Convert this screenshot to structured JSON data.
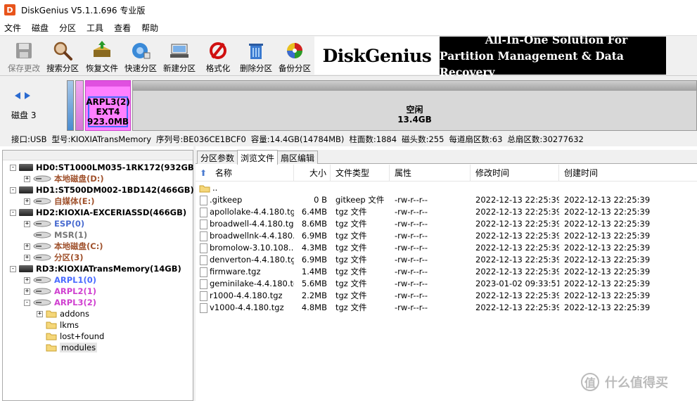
{
  "title": "DiskGenius V5.1.1.696 专业版",
  "menu": [
    "文件",
    "磁盘",
    "分区",
    "工具",
    "查看",
    "帮助"
  ],
  "toolbar": [
    {
      "label": "保存更改",
      "icon": "save-icon"
    },
    {
      "label": "搜索分区",
      "icon": "search-partition-icon"
    },
    {
      "label": "恢复文件",
      "icon": "recover-files-icon"
    },
    {
      "label": "快速分区",
      "icon": "quick-partition-icon"
    },
    {
      "label": "新建分区",
      "icon": "new-partition-icon"
    },
    {
      "label": "格式化",
      "icon": "format-icon"
    },
    {
      "label": "删除分区",
      "icon": "delete-partition-icon"
    },
    {
      "label": "备份分区",
      "icon": "backup-partition-icon"
    }
  ],
  "banner": {
    "logo": "DiskGenius",
    "line1": "All-In-One Solution For",
    "line2": "Partition Management & Data Recovery"
  },
  "diskmap": {
    "disk_label": "磁盘 3",
    "selected": {
      "name": "ARPL3(2)",
      "fs": "EXT4",
      "size": "923.0MB"
    },
    "free": {
      "name": "空闲",
      "size": "13.4GB"
    }
  },
  "infobar": [
    "接口:USB",
    "型号:KIOXIATransMemory",
    "序列号:BE036CE1BCF0",
    "容量:14.4GB(14784MB)",
    "柱面数:1884",
    "磁头数:255",
    "每道扇区数:63",
    "总扇区数:30277632"
  ],
  "tree": [
    {
      "label": "HD0:ST1000LM035-1RK172(932GB)",
      "style": "disk",
      "exp": "-"
    },
    {
      "label": "本地磁盘(D:)",
      "style": "ntfs",
      "exp": "+"
    },
    {
      "label": "HD1:ST500DM002-1BD142(466GB)",
      "style": "disk",
      "exp": "-"
    },
    {
      "label": "自媒体(E:)",
      "style": "ntfs",
      "exp": "+"
    },
    {
      "label": "HD2:KIOXIA-EXCERIASSD(466GB)",
      "style": "disk",
      "exp": "-"
    },
    {
      "label": "ESP(0)",
      "style": "fat",
      "exp": "+"
    },
    {
      "label": "MSR(1)",
      "style": "msr",
      "exp": ""
    },
    {
      "label": "本地磁盘(C:)",
      "style": "ntfs",
      "exp": "+"
    },
    {
      "label": "分区(3)",
      "style": "ntfs",
      "exp": "+"
    },
    {
      "label": "RD3:KIOXIATransMemory(14GB)",
      "style": "disk",
      "exp": "-"
    },
    {
      "label": "ARPL1(0)",
      "style": "arpl1",
      "exp": "+"
    },
    {
      "label": "ARPL2(1)",
      "style": "arpl2",
      "exp": "+"
    },
    {
      "label": "ARPL3(2)",
      "style": "arpl3",
      "exp": "-"
    },
    {
      "label": "addons",
      "style": "dir",
      "exp": "+"
    },
    {
      "label": "lkms",
      "style": "dir",
      "exp": ""
    },
    {
      "label": "lost+found",
      "style": "dir",
      "exp": ""
    },
    {
      "label": "modules",
      "style": "dir-sel",
      "exp": ""
    }
  ],
  "tabs": [
    "分区参数",
    "浏览文件",
    "扇区编辑"
  ],
  "active_tab": 1,
  "columns": [
    "名称",
    "大小",
    "文件类型",
    "属性",
    "修改时间",
    "创建时间"
  ],
  "parent_dir": "..",
  "files": [
    {
      "name": ".gitkeep",
      "size": "0 B",
      "type": "gitkeep 文件",
      "attr": "-rw-r--r--",
      "modified": "2022-12-13 22:25:39",
      "created": "2022-12-13 22:25:39"
    },
    {
      "name": "apollolake-4.4.180.tgz",
      "size": "6.4MB",
      "type": "tgz 文件",
      "attr": "-rw-r--r--",
      "modified": "2022-12-13 22:25:39",
      "created": "2022-12-13 22:25:39"
    },
    {
      "name": "broadwell-4.4.180.tgz",
      "size": "8.6MB",
      "type": "tgz 文件",
      "attr": "-rw-r--r--",
      "modified": "2022-12-13 22:25:39",
      "created": "2022-12-13 22:25:39"
    },
    {
      "name": "broadwellnk-4.4.180....",
      "size": "6.9MB",
      "type": "tgz 文件",
      "attr": "-rw-r--r--",
      "modified": "2022-12-13 22:25:39",
      "created": "2022-12-13 22:25:39"
    },
    {
      "name": "bromolow-3.10.108....",
      "size": "4.3MB",
      "type": "tgz 文件",
      "attr": "-rw-r--r--",
      "modified": "2022-12-13 22:25:39",
      "created": "2022-12-13 22:25:39"
    },
    {
      "name": "denverton-4.4.180.tgz",
      "size": "6.9MB",
      "type": "tgz 文件",
      "attr": "-rw-r--r--",
      "modified": "2022-12-13 22:25:39",
      "created": "2022-12-13 22:25:39"
    },
    {
      "name": "firmware.tgz",
      "size": "1.4MB",
      "type": "tgz 文件",
      "attr": "-rw-r--r--",
      "modified": "2022-12-13 22:25:39",
      "created": "2022-12-13 22:25:39"
    },
    {
      "name": "geminilake-4.4.180.tgz",
      "size": "5.6MB",
      "type": "tgz 文件",
      "attr": "-rw-r--r--",
      "modified": "2023-01-02 09:33:51",
      "created": "2022-12-13 22:25:39"
    },
    {
      "name": "r1000-4.4.180.tgz",
      "size": "2.2MB",
      "type": "tgz 文件",
      "attr": "-rw-r--r--",
      "modified": "2022-12-13 22:25:39",
      "created": "2022-12-13 22:25:39"
    },
    {
      "name": "v1000-4.4.180.tgz",
      "size": "4.8MB",
      "type": "tgz 文件",
      "attr": "-rw-r--r--",
      "modified": "2022-12-13 22:25:39",
      "created": "2022-12-13 22:25:39"
    }
  ],
  "watermark": "什么值得买",
  "watermark_icon": "值",
  "colors": {
    "selected_partition": "#ff80ff",
    "ntfs": "#a0522d",
    "arpl1": "#4a6cff",
    "arpl": "#d040d0"
  }
}
